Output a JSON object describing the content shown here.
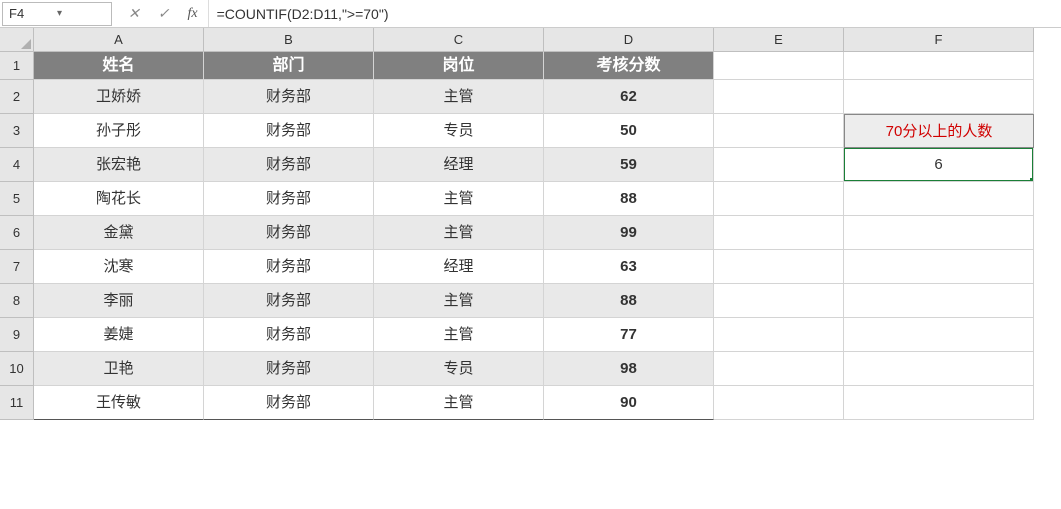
{
  "nameBox": "F4",
  "formula": "=COUNTIF(D2:D11,\">=70\")",
  "columns": [
    "A",
    "B",
    "C",
    "D",
    "E",
    "F"
  ],
  "rows": [
    "1",
    "2",
    "3",
    "4",
    "5",
    "6",
    "7",
    "8",
    "9",
    "10",
    "11"
  ],
  "headers": {
    "name": "姓名",
    "dept": "部门",
    "role": "岗位",
    "score": "考核分数"
  },
  "data": [
    {
      "name": "卫娇娇",
      "dept": "财务部",
      "role": "主管",
      "score": "62"
    },
    {
      "name": "孙子彤",
      "dept": "财务部",
      "role": "专员",
      "score": "50"
    },
    {
      "name": "张宏艳",
      "dept": "财务部",
      "role": "经理",
      "score": "59"
    },
    {
      "name": "陶花长",
      "dept": "财务部",
      "role": "主管",
      "score": "88"
    },
    {
      "name": "金黛",
      "dept": "财务部",
      "role": "主管",
      "score": "99"
    },
    {
      "name": "沈寒",
      "dept": "财务部",
      "role": "经理",
      "score": "63"
    },
    {
      "name": "李丽",
      "dept": "财务部",
      "role": "主管",
      "score": "88"
    },
    {
      "name": "姜婕",
      "dept": "财务部",
      "role": "主管",
      "score": "77"
    },
    {
      "name": "卫艳",
      "dept": "财务部",
      "role": "专员",
      "score": "98"
    },
    {
      "name": "王传敏",
      "dept": "财务部",
      "role": "主管",
      "score": "90"
    }
  ],
  "sidebar": {
    "label": "70分以上的人数",
    "value": "6"
  },
  "icons": {
    "cancel": "✕",
    "enter": "✓",
    "fx": "fx",
    "dropdown": "▾"
  },
  "chart_data": {
    "type": "table",
    "title": "考核分数",
    "columns": [
      "姓名",
      "部门",
      "岗位",
      "考核分数"
    ],
    "rows": [
      [
        "卫娇娇",
        "财务部",
        "主管",
        62
      ],
      [
        "孙子彤",
        "财务部",
        "专员",
        50
      ],
      [
        "张宏艳",
        "财务部",
        "经理",
        59
      ],
      [
        "陶花长",
        "财务部",
        "主管",
        88
      ],
      [
        "金黛",
        "财务部",
        "主管",
        99
      ],
      [
        "沈寒",
        "财务部",
        "经理",
        63
      ],
      [
        "李丽",
        "财务部",
        "主管",
        88
      ],
      [
        "姜婕",
        "财务部",
        "主管",
        77
      ],
      [
        "卫艳",
        "财务部",
        "专员",
        98
      ],
      [
        "王传敏",
        "财务部",
        "主管",
        90
      ]
    ],
    "summary": {
      "label": "70分以上的人数",
      "value": 6,
      "formula": "=COUNTIF(D2:D11,\">=70\")"
    }
  }
}
